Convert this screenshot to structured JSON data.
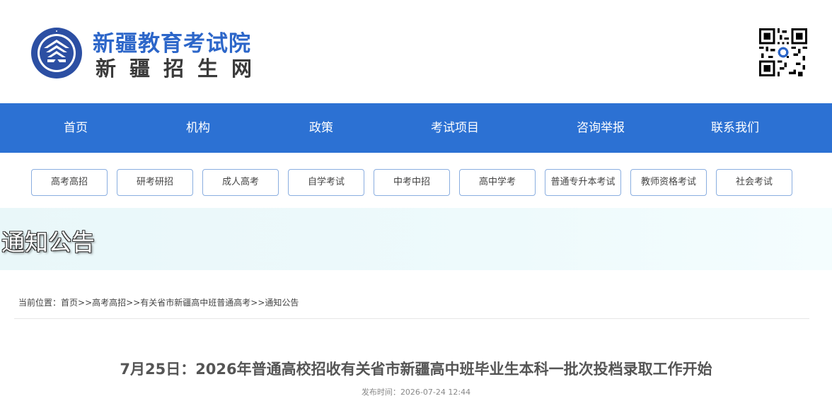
{
  "header": {
    "site_title": "新疆教育考试院",
    "site_subtitle": "新疆招生网",
    "emblem_text": "新疆教育考试院"
  },
  "nav": {
    "items": [
      {
        "label": "首页"
      },
      {
        "label": "机构"
      },
      {
        "label": "政策"
      },
      {
        "label": "考试项目"
      },
      {
        "label": "咨询举报"
      },
      {
        "label": "联系我们"
      }
    ]
  },
  "subnav": {
    "items": [
      {
        "label": "高考高招"
      },
      {
        "label": "研考研招"
      },
      {
        "label": "成人高考"
      },
      {
        "label": "自学考试"
      },
      {
        "label": "中考中招"
      },
      {
        "label": "高中学考"
      },
      {
        "label": "普通专升本考试"
      },
      {
        "label": "教师资格考试"
      },
      {
        "label": "社会考试"
      }
    ]
  },
  "banner": {
    "title": "通知公告"
  },
  "breadcrumb": {
    "prefix": "当前位置：",
    "items": [
      "首页",
      "高考高招",
      "有关省市新疆高中班普通高考",
      "通知公告"
    ],
    "separator": ">>"
  },
  "article": {
    "title": "7月25日：2026年普通高校招收有关省市新疆高中班毕业生本科一批次投档录取工作开始",
    "date_label": "发布时间：",
    "date": "2026-07-24 12:44"
  },
  "colors": {
    "brand_blue": "#2c66c9",
    "nav_bg": "#2c71d3",
    "button_border": "#8aaee0",
    "banner_bg": "#eaf8fa"
  }
}
